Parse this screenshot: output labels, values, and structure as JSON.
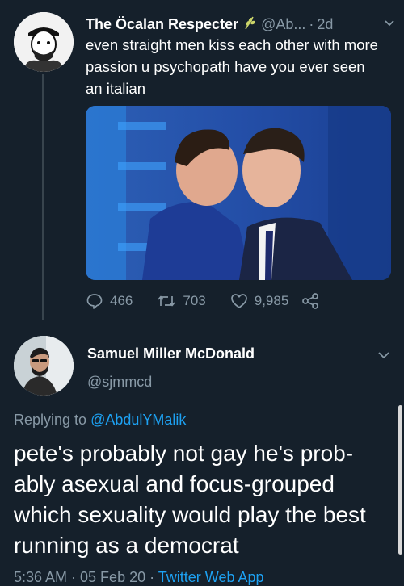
{
  "tweet1": {
    "display_name": "The Öcalan Respecter",
    "badge_icon": "wheat-icon",
    "handle": "@Ab...",
    "separator": "·",
    "time": "2d",
    "text": "even straight men kiss each other with more passion u psychopath have you ever seen an italian",
    "stats": {
      "replies": "466",
      "retweets": "703",
      "likes": "9,985"
    }
  },
  "tweet2": {
    "display_name": "Samuel Miller McDonald",
    "handle": "@sjmmcd",
    "replying_prefix": "Replying to",
    "replying_to": "@AbdulYMalik",
    "text": "pete's probably not gay he's prob-ably asexual and focus-grouped which sexuality would play the best running as a democrat",
    "time": "5:36 AM · 05 Feb 20 ·",
    "source": "Twitter Web App"
  },
  "colors": {
    "background": "#15202b",
    "secondary_text": "#8899a6",
    "link": "#1da1f2",
    "thread_line": "#38444d"
  }
}
